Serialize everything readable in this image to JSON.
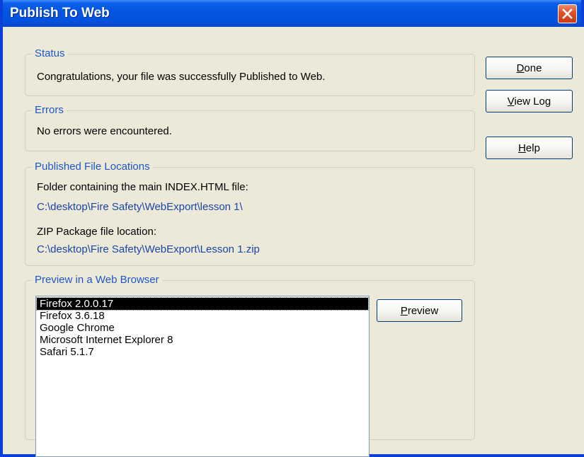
{
  "window": {
    "title": "Publish To Web"
  },
  "status": {
    "legend": "Status",
    "message": "Congratulations, your file was successfully Published to Web."
  },
  "errors": {
    "legend": "Errors",
    "message": "No errors were encountered."
  },
  "locations": {
    "legend": "Published File Locations",
    "folder_label": "Folder containing the main INDEX.HTML file:",
    "folder_path": "C:\\desktop\\Fire Safety\\WebExport\\lesson 1\\",
    "zip_label": "ZIP Package file location:",
    "zip_path": "C:\\desktop\\Fire Safety\\WebExport\\Lesson 1.zip"
  },
  "preview": {
    "legend": "Preview in a Web Browser",
    "browsers": [
      "Firefox 2.0.0.17",
      "Firefox 3.6.18",
      "Google Chrome",
      "Microsoft Internet Explorer 8",
      "Safari 5.1.7"
    ],
    "selected": "Firefox 2.0.0.17",
    "button_mnemonic": "P",
    "button_rest": "review"
  },
  "buttons": {
    "done": {
      "mnemonic": "D",
      "rest": "one"
    },
    "view_log": {
      "mnemonic": "V",
      "rest": "iew Log"
    },
    "help": {
      "mnemonic": "H",
      "rest": "elp"
    }
  },
  "colors": {
    "titlebar": "#0355e0",
    "face": "#ece9d8",
    "legend_text": "#1f57c7",
    "path_text": "#1a45a8",
    "close_button": "#e0542c"
  },
  "icons": {
    "close": "close-x-icon"
  }
}
